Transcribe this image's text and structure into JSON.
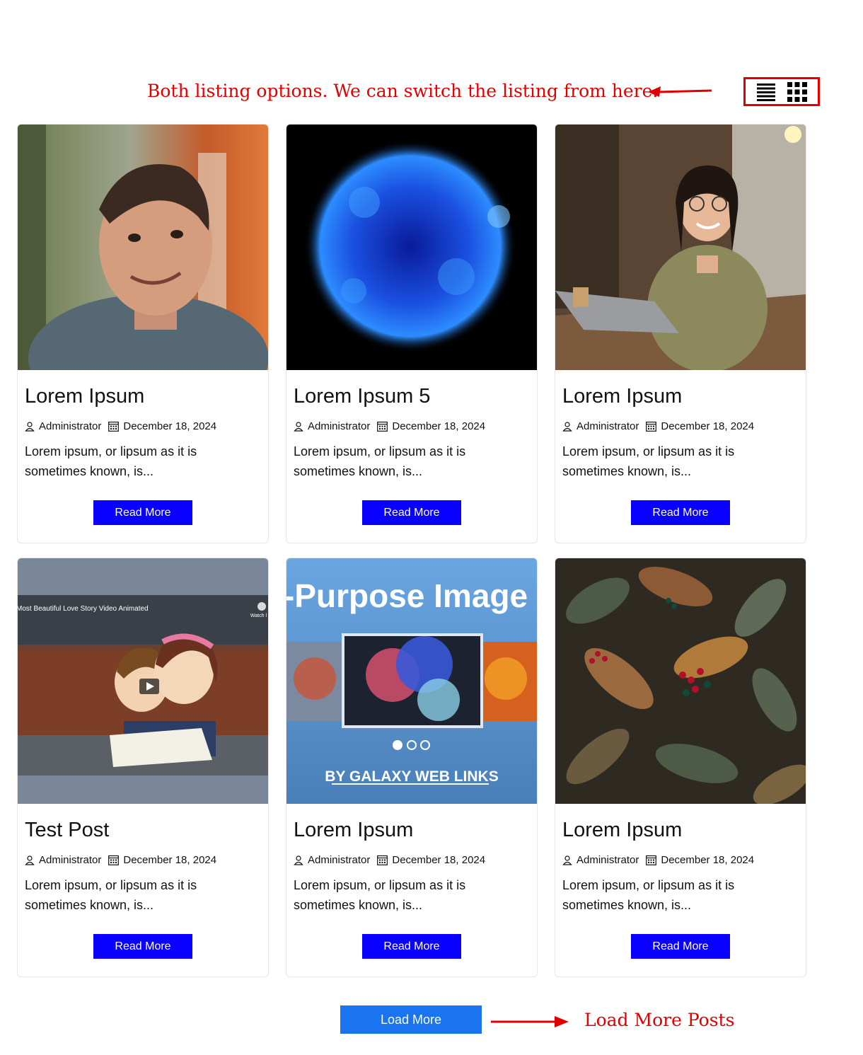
{
  "annotations": {
    "top": "Both listing options. We can switch the listing from here.",
    "bottom": "Load More Posts"
  },
  "view_switcher": {
    "list_icon": "list-view-icon",
    "grid_icon": "grid-view-icon"
  },
  "posts": [
    {
      "title": "Lorem Ipsum",
      "author": "Administrator",
      "date": "December 18, 2024",
      "excerpt": "Lorem ipsum, or lipsum as it is sometimes known, is...",
      "button": "Read More",
      "image": "man-portrait-photo"
    },
    {
      "title": "Lorem Ipsum 5",
      "author": "Administrator",
      "date": "December 18, 2024",
      "excerpt": "Lorem ipsum, or lipsum as it is sometimes known, is...",
      "button": "Read More",
      "image": "blue-sun-photo"
    },
    {
      "title": "Lorem Ipsum",
      "author": "Administrator",
      "date": "December 18, 2024",
      "excerpt": "Lorem ipsum, or lipsum as it is sometimes known, is...",
      "button": "Read More",
      "image": "woman-laptop-photo"
    },
    {
      "title": "Test Post",
      "author": "Administrator",
      "date": "December 18, 2024",
      "excerpt": "Lorem ipsum, or lipsum as it is sometimes known, is...",
      "button": "Read More",
      "image": "animated-video-thumbnail",
      "video_caption": "Most Beautiful Love Story Video Animated",
      "watch_label": "Watch l"
    },
    {
      "title": "Lorem Ipsum",
      "author": "Administrator",
      "date": "December 18, 2024",
      "excerpt": "Lorem ipsum, or lipsum as it is sometimes known, is...",
      "button": "Read More",
      "image": "slider-banner-image",
      "banner_heading": "-Purpose Image -",
      "banner_footer": "BY GALAXY WEB LINKS"
    },
    {
      "title": "Lorem Ipsum",
      "author": "Administrator",
      "date": "December 18, 2024",
      "excerpt": "Lorem ipsum, or lipsum as it is sometimes known, is...",
      "button": "Read More",
      "image": "berries-leaves-photo"
    }
  ],
  "load_more": "Load More",
  "colors": {
    "annotation": "#e00000",
    "read_more_bg": "#0a00ff",
    "load_more_bg": "#1a74f0"
  }
}
